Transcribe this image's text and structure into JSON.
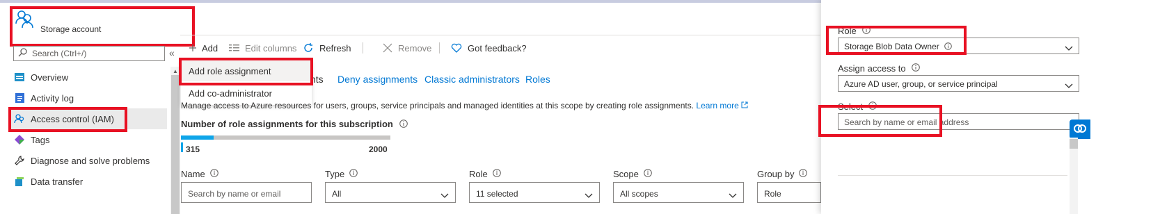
{
  "colors": {
    "accent": "#0078d4",
    "highlight_box": "#e81123",
    "progress": "#0ea5e9"
  },
  "resource": {
    "label": "Storage account",
    "icon": "users-icon"
  },
  "sidebar": {
    "search_placeholder": "Search (Ctrl+/)",
    "collapse_glyph": "«",
    "items": [
      {
        "label": "Overview",
        "icon": "overview-icon"
      },
      {
        "label": "Activity log",
        "icon": "activity-log-icon"
      },
      {
        "label": "Access control (IAM)",
        "icon": "iam-icon",
        "active": true
      },
      {
        "label": "Tags",
        "icon": "tag-icon"
      },
      {
        "label": "Diagnose and solve problems",
        "icon": "wrench-icon"
      },
      {
        "label": "Data transfer",
        "icon": "data-transfer-icon"
      }
    ]
  },
  "toolbar": {
    "add": "Add",
    "edit_columns": "Edit columns",
    "refresh": "Refresh",
    "remove": "Remove",
    "feedback": "Got feedback?"
  },
  "add_menu": {
    "items": [
      "Add role assignment",
      "Add co-administrator"
    ]
  },
  "tabs": {
    "hidden_fragment": "nts",
    "items": [
      "Deny assignments",
      "Classic administrators",
      "Roles"
    ]
  },
  "main": {
    "description": "Manage access to Azure resources for users, groups, service principals and managed identities at this scope by creating role assignments.",
    "learn_more": "Learn more",
    "assignments_title": "Number of role assignments for this subscription",
    "assignments_current": "315",
    "assignments_max": "2000",
    "assignments_fraction": 0.1575
  },
  "filters": {
    "name": {
      "label": "Name",
      "placeholder": "Search by name or email"
    },
    "type": {
      "label": "Type",
      "value": "All"
    },
    "role": {
      "label": "Role",
      "value": "11 selected"
    },
    "scope": {
      "label": "Scope",
      "value": "All scopes"
    },
    "group_by": {
      "label": "Group by",
      "value": "Role"
    }
  },
  "panel": {
    "role_label": "Role",
    "role_value": "Storage Blob Data Owner",
    "assign_label": "Assign access to",
    "assign_value": "Azure AD user, group, or service principal",
    "select_label": "Select",
    "select_placeholder": "Search by name or email address"
  }
}
